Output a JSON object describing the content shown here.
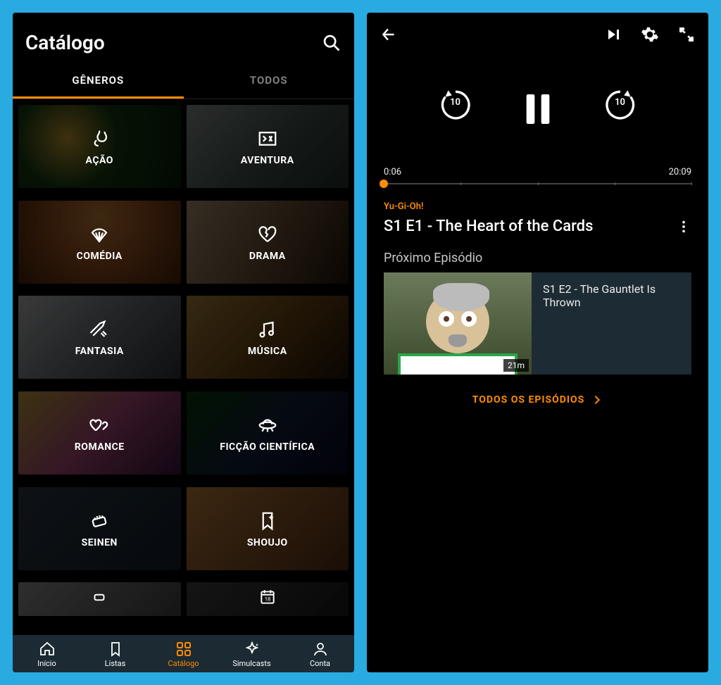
{
  "left": {
    "header_title": "Catálogo",
    "tabs": [
      "GÊNEROS",
      "TODOS"
    ],
    "active_tab_index": 0,
    "genres": [
      {
        "key": "acao",
        "label": "AÇÃO"
      },
      {
        "key": "aventura",
        "label": "AVENTURA"
      },
      {
        "key": "comedia",
        "label": "COMÉDIA"
      },
      {
        "key": "drama",
        "label": "DRAMA"
      },
      {
        "key": "fantasia",
        "label": "FANTASIA"
      },
      {
        "key": "musica",
        "label": "MÚSICA"
      },
      {
        "key": "romance",
        "label": "ROMANCE"
      },
      {
        "key": "ficcao",
        "label": "FICÇÃO CIENTÍFICA"
      },
      {
        "key": "seinen",
        "label": "SEINEN"
      },
      {
        "key": "shoujo",
        "label": "SHOUJO"
      }
    ],
    "nav": [
      {
        "key": "inicio",
        "label": "Início"
      },
      {
        "key": "listas",
        "label": "Listas"
      },
      {
        "key": "catalogo",
        "label": "Catálogo"
      },
      {
        "key": "simulcasts",
        "label": "Simulcasts"
      },
      {
        "key": "conta",
        "label": "Conta"
      }
    ],
    "active_nav_index": 2
  },
  "right": {
    "current_time": "0:06",
    "total_time": "20:09",
    "series": "Yu-Gi-Oh!",
    "episode_title": "S1 E1 - The Heart of the Cards",
    "next_label": "Próximo Episódio",
    "next_episode": {
      "title": "S1 E2 - The Gauntlet Is Thrown",
      "duration": "21m"
    },
    "all_episodes_label": "TODOS OS EPISÓDIOS",
    "rewind_seconds": "10",
    "forward_seconds": "10"
  },
  "colors": {
    "accent": "#ff8c00",
    "app_bg": "#000000",
    "page_bg": "#29abe2",
    "bottom_nav_bg": "#1c2a33"
  }
}
